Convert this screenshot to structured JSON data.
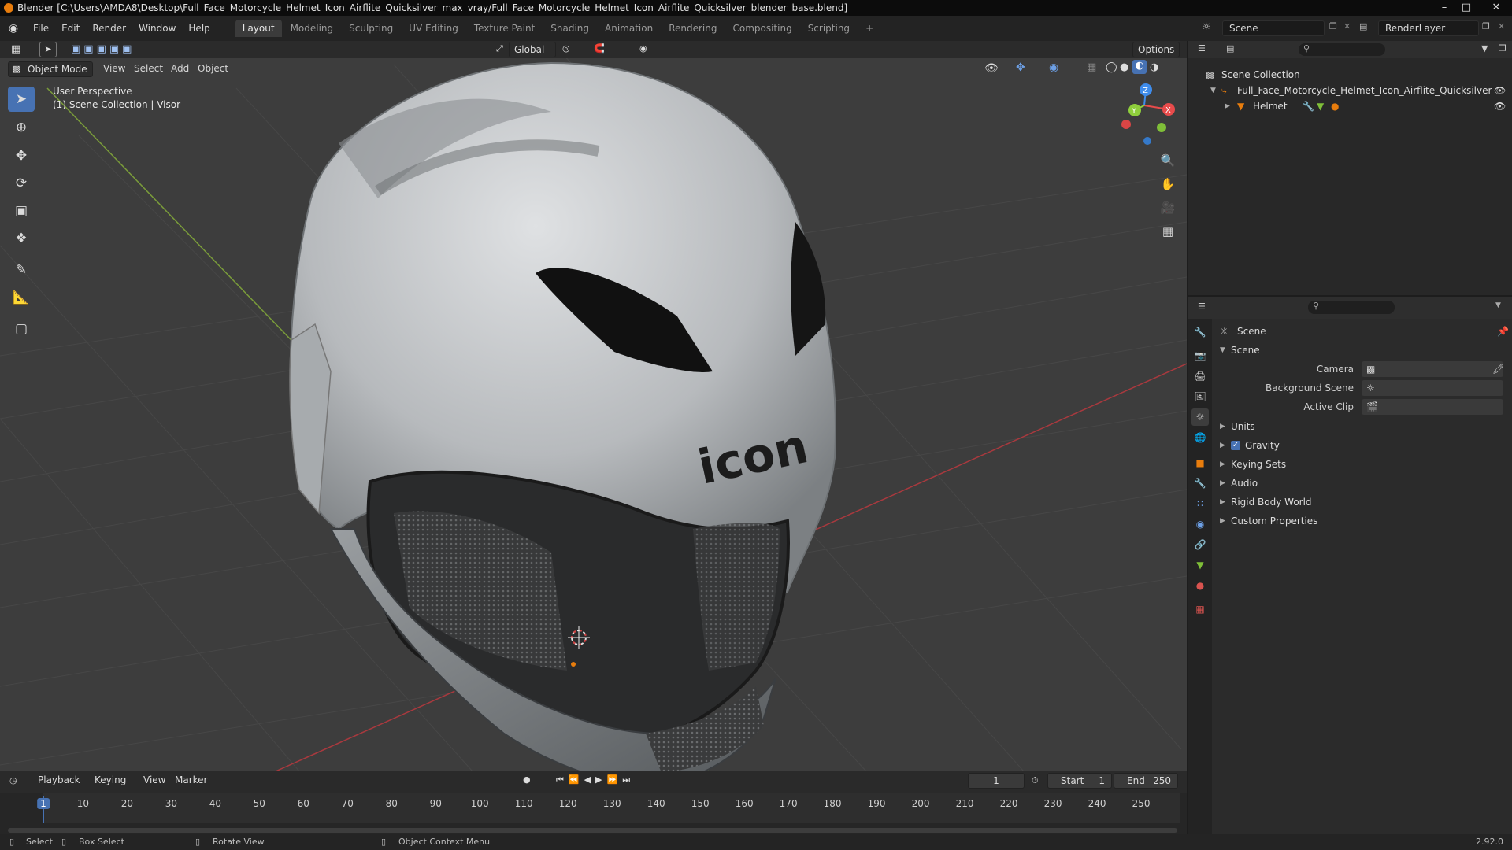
{
  "title_bar": "Blender [C:\\Users\\AMDA8\\Desktop\\Full_Face_Motorcycle_Helmet_Icon_Airflite_Quicksilver_max_vray/Full_Face_Motorcycle_Helmet_Icon_Airflite_Quicksilver_blender_base.blend]",
  "menu": [
    "File",
    "Edit",
    "Render",
    "Window",
    "Help"
  ],
  "workspace_tabs": [
    "Layout",
    "Modeling",
    "Sculpting",
    "UV Editing",
    "Texture Paint",
    "Shading",
    "Animation",
    "Rendering",
    "Compositing",
    "Scripting"
  ],
  "active_workspace": "Layout",
  "add_tab": "+",
  "scene_field": "Scene",
  "render_layer_field": "RenderLayer",
  "viewport": {
    "transform_orientation": "Global",
    "options_label": "Options",
    "mode": "Object Mode",
    "menus": [
      "View",
      "Select",
      "Add",
      "Object"
    ],
    "overlay_line1": "User Perspective",
    "overlay_line2": "(1) Scene Collection | Visor",
    "helmet_logo_text": "icon",
    "gizmo_axes": [
      "Z",
      "X",
      "Y"
    ]
  },
  "outliner": {
    "root": "Scene Collection",
    "items": [
      {
        "label": "Full_Face_Motorcycle_Helmet_Icon_Airflite_Quicksilver"
      },
      {
        "label": "Helmet"
      }
    ]
  },
  "properties": {
    "context": "Scene",
    "panel_title": "Scene",
    "fields": [
      {
        "label": "Camera"
      },
      {
        "label": "Background Scene"
      },
      {
        "label": "Active Clip"
      }
    ],
    "subpanels": [
      "Units",
      "Gravity",
      "Keying Sets",
      "Audio",
      "Rigid Body World",
      "Custom Properties"
    ],
    "gravity_checked": true
  },
  "timeline": {
    "menus": [
      "Playback",
      "Keying",
      "View",
      "Marker"
    ],
    "current_frame": "1",
    "start_label": "Start",
    "start_value": "1",
    "end_label": "End",
    "end_value": "250",
    "frame_ticks": [
      "1",
      "10",
      "20",
      "30",
      "40",
      "50",
      "60",
      "70",
      "80",
      "90",
      "100",
      "110",
      "120",
      "130",
      "140",
      "150",
      "160",
      "170",
      "180",
      "190",
      "200",
      "210",
      "220",
      "230",
      "240",
      "250"
    ]
  },
  "statusbar": {
    "items": [
      "Select",
      "Box Select",
      "Rotate View",
      "Object Context Menu"
    ],
    "version": "2.92.0"
  },
  "colors": {
    "accent": "#4772b3",
    "x_axis": "#e84b4b",
    "y_axis": "#8fcf3c",
    "z_axis": "#3f8ceb",
    "object_orange": "#e87d0d"
  }
}
